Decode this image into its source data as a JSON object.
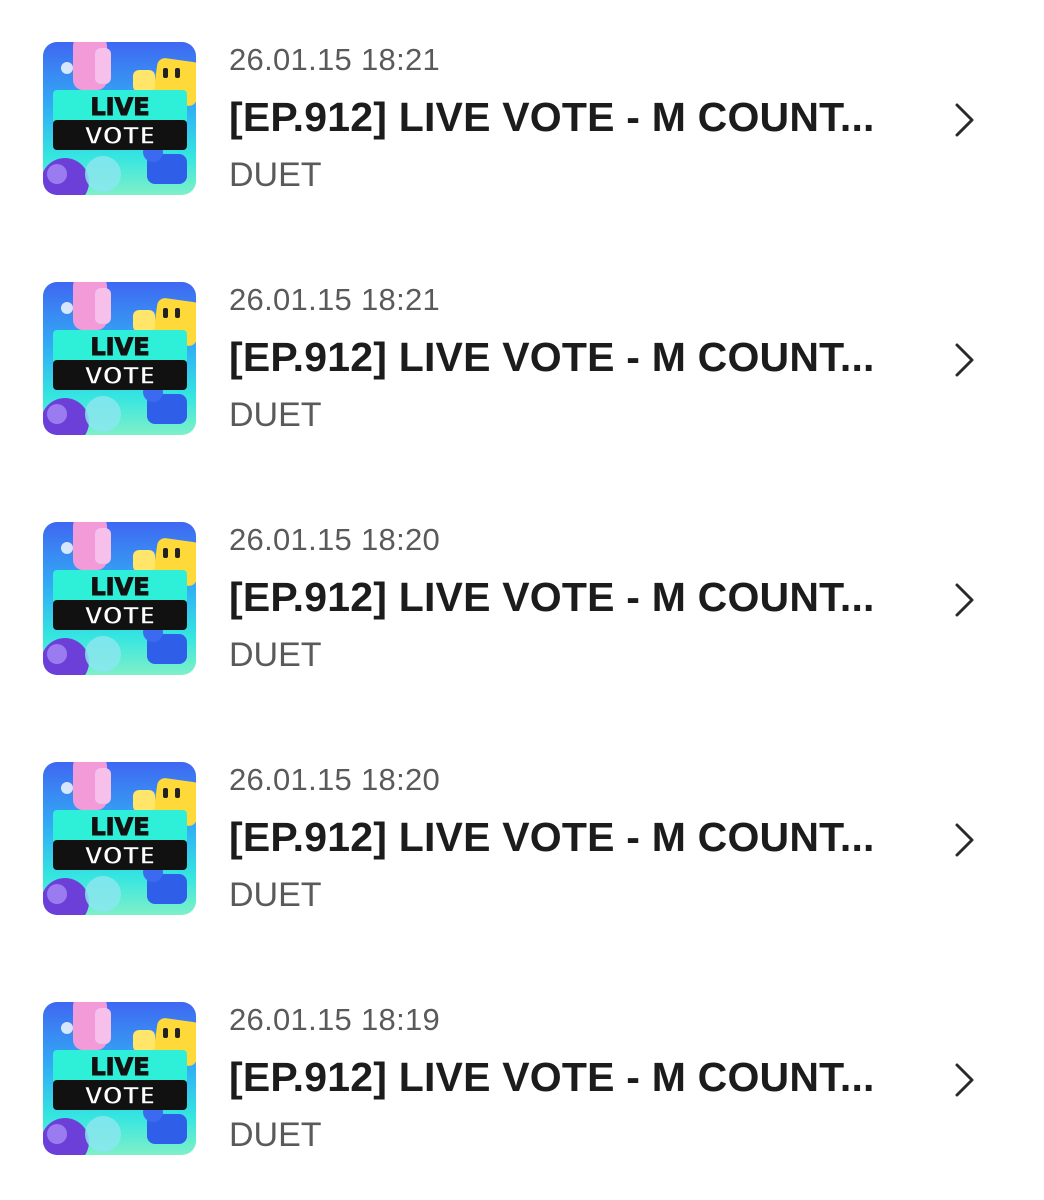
{
  "items": [
    {
      "date": "26.01.15 18:21",
      "title": "[EP.912] LIVE VOTE - M COUNT...",
      "subtitle": "DUET",
      "thumb_text": [
        "LIVE",
        "VOTE"
      ]
    },
    {
      "date": "26.01.15 18:21",
      "title": "[EP.912] LIVE VOTE - M COUNT...",
      "subtitle": "DUET",
      "thumb_text": [
        "LIVE",
        "VOTE"
      ]
    },
    {
      "date": "26.01.15 18:20",
      "title": "[EP.912] LIVE VOTE - M COUNT...",
      "subtitle": "DUET",
      "thumb_text": [
        "LIVE",
        "VOTE"
      ]
    },
    {
      "date": "26.01.15 18:20",
      "title": "[EP.912] LIVE VOTE - M COUNT...",
      "subtitle": "DUET",
      "thumb_text": [
        "LIVE",
        "VOTE"
      ]
    },
    {
      "date": "26.01.15 18:19",
      "title": "[EP.912] LIVE VOTE - M COUNT...",
      "subtitle": "DUET",
      "thumb_text": [
        "LIVE",
        "VOTE"
      ]
    }
  ],
  "icons": {
    "chevron": "chevron-right-icon"
  },
  "colors": {
    "title": "#1c1c1c",
    "meta": "#5a5a5a",
    "thumb_banner": "#2ef0d8",
    "thumb_band": "#111111"
  }
}
